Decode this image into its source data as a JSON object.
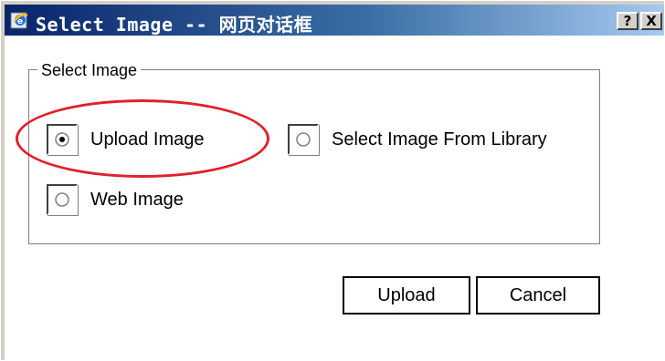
{
  "window": {
    "title": "Select Image -- 网页对话框",
    "help_label": "?",
    "close_label": "X"
  },
  "group": {
    "legend": "Select Image",
    "options": [
      {
        "label": "Upload Image",
        "checked": true
      },
      {
        "label": "Select Image From Library",
        "checked": false
      },
      {
        "label": "Web Image",
        "checked": false
      }
    ]
  },
  "buttons": {
    "upload": "Upload",
    "cancel": "Cancel"
  },
  "colors": {
    "titlebar_start": "#0a246a",
    "titlebar_end": "#a6caf0",
    "highlight": "#e0202c"
  }
}
